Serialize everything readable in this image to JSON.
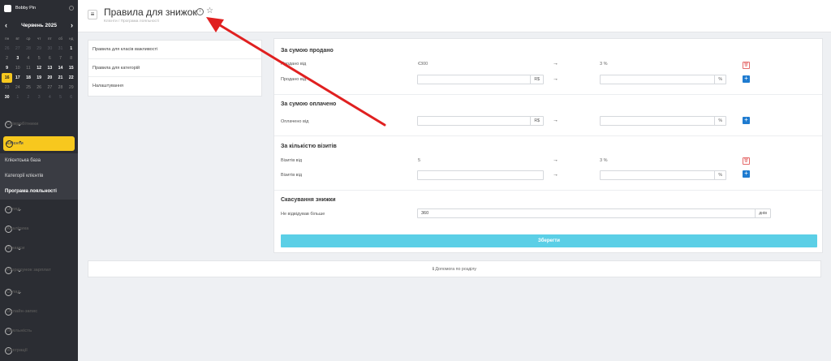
{
  "sidebar": {
    "user_name": "Bobby Pin",
    "calendar": {
      "month_label": "Червень 2025",
      "weekdays": [
        "пн",
        "вт",
        "ср",
        "чт",
        "пт",
        "сб",
        "нд"
      ],
      "days": [
        {
          "d": "26",
          "s": "dim"
        },
        {
          "d": "27",
          "s": "dim"
        },
        {
          "d": "28",
          "s": "dim"
        },
        {
          "d": "29",
          "s": "dim"
        },
        {
          "d": "30",
          "s": "dim"
        },
        {
          "d": "31",
          "s": "dim"
        },
        {
          "d": "1",
          "s": "b"
        },
        {
          "d": "2",
          "s": ""
        },
        {
          "d": "3",
          "s": "b"
        },
        {
          "d": "4",
          "s": ""
        },
        {
          "d": "5",
          "s": ""
        },
        {
          "d": "6",
          "s": ""
        },
        {
          "d": "7",
          "s": ""
        },
        {
          "d": "8",
          "s": ""
        },
        {
          "d": "9",
          "s": "b"
        },
        {
          "d": "10",
          "s": ""
        },
        {
          "d": "11",
          "s": ""
        },
        {
          "d": "12",
          "s": "b"
        },
        {
          "d": "13",
          "s": "b"
        },
        {
          "d": "14",
          "s": "b"
        },
        {
          "d": "15",
          "s": "b"
        },
        {
          "d": "16",
          "s": "today"
        },
        {
          "d": "17",
          "s": "b"
        },
        {
          "d": "18",
          "s": "b"
        },
        {
          "d": "19",
          "s": "b"
        },
        {
          "d": "20",
          "s": "b"
        },
        {
          "d": "21",
          "s": "b"
        },
        {
          "d": "22",
          "s": "b"
        },
        {
          "d": "23",
          "s": ""
        },
        {
          "d": "24",
          "s": ""
        },
        {
          "d": "25",
          "s": ""
        },
        {
          "d": "26",
          "s": ""
        },
        {
          "d": "27",
          "s": ""
        },
        {
          "d": "28",
          "s": ""
        },
        {
          "d": "29",
          "s": ""
        },
        {
          "d": "30",
          "s": "b"
        },
        {
          "d": "1",
          "s": "dim"
        },
        {
          "d": "2",
          "s": "dim"
        },
        {
          "d": "3",
          "s": "dim"
        },
        {
          "d": "4",
          "s": "dim"
        },
        {
          "d": "5",
          "s": "dim"
        },
        {
          "d": "6",
          "s": "dim"
        }
      ]
    },
    "menu": {
      "staff": "Співробітники",
      "clients": "Клієнти",
      "clients_sub": [
        "Клієнтська база",
        "Категорії клієнтів",
        "Програма лояльності"
      ],
      "overview": "Огляд",
      "analytics": "Аналітика",
      "finance": "Фінанси",
      "payroll": "Розрахунок зарплат",
      "warehouse": "Склад",
      "online": "Онлайн-запис",
      "loyalty": "Лояльність",
      "integrations": "Інтеграції"
    }
  },
  "header": {
    "title": "Правила для знижок",
    "breadcrumb": "Клієнти  /  Програма лояльності"
  },
  "rules_list": [
    "Правила для класів важливості",
    "Правила для категорій",
    "Налаштування"
  ],
  "sections": {
    "sold": {
      "title": "За сумою продано",
      "row1": {
        "label": "Продано від",
        "from": "€300",
        "to": "3 %"
      },
      "row2": {
        "label": "Продано від",
        "from_suffix": "R$",
        "to_suffix": "%"
      }
    },
    "paid": {
      "title": "За сумою оплачено",
      "row1": {
        "label": "Оплачено від",
        "from_suffix": "R$",
        "to_suffix": "%"
      }
    },
    "visits": {
      "title": "За кількістю візитів",
      "row1": {
        "label": "Візитів від",
        "from": "5",
        "to": "3 %"
      },
      "row2": {
        "label": "Візитів від",
        "to_suffix": "%"
      }
    },
    "cancel": {
      "title": "Скасування знижки",
      "label": "Не відвідував більше",
      "value": "360",
      "suffix": "днів"
    }
  },
  "arrow_glyph": "→",
  "save_label": "Зберегти",
  "help_label": "Допомога по розділу",
  "colors": {
    "accent": "#f7c81e",
    "save": "#5bcfe6",
    "add": "#1e7bd0",
    "delete": "#e56b6b",
    "annotation": "#e02020"
  }
}
